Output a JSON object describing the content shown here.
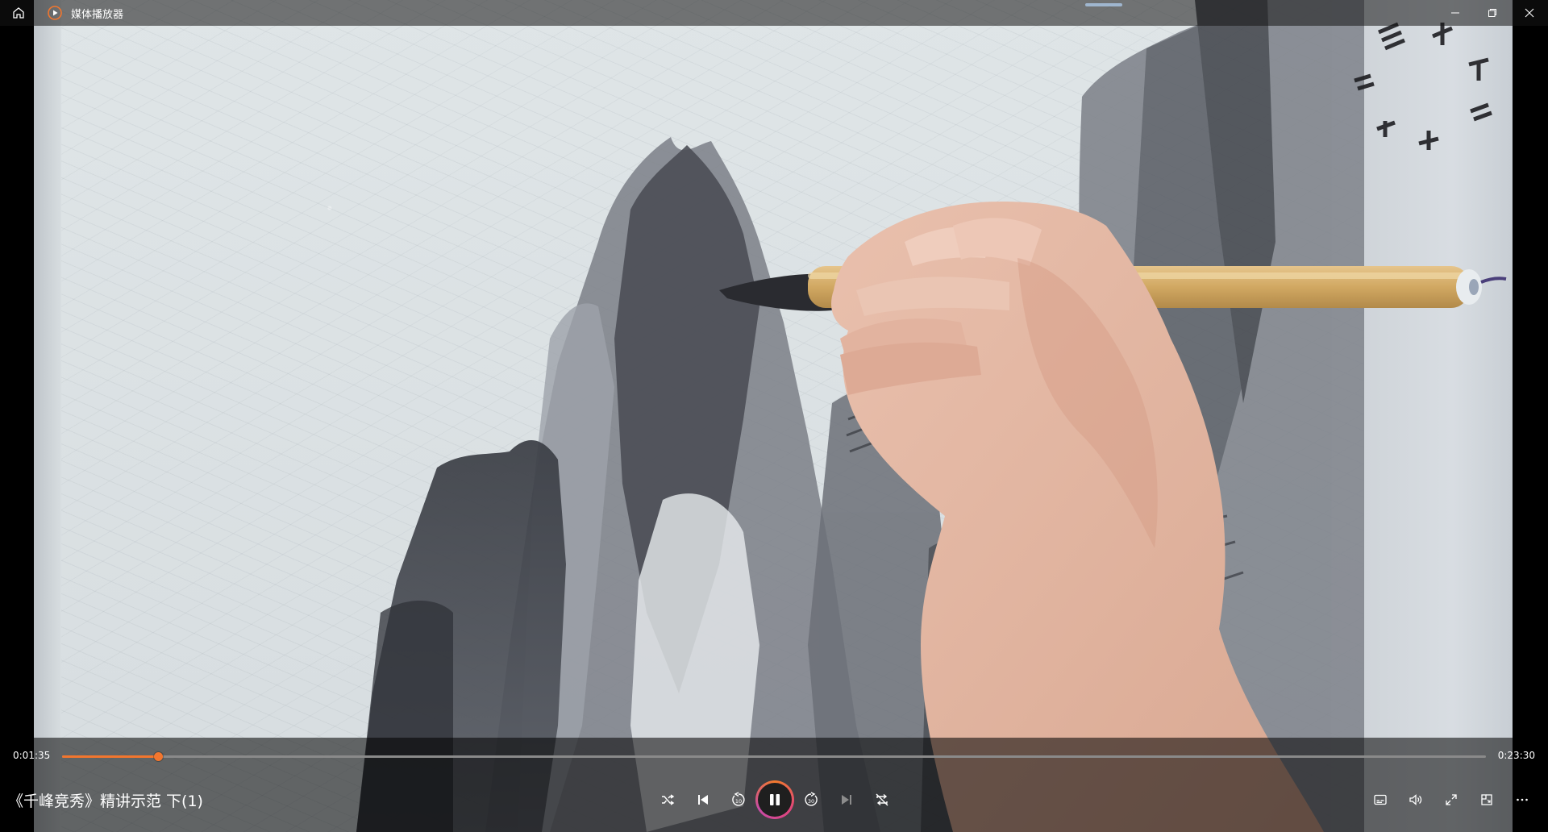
{
  "window": {
    "title": "媒体播放器",
    "controls": [
      "minimize-icon",
      "restore-icon",
      "close-icon"
    ]
  },
  "player": {
    "current_time": "0:01:35",
    "total_time": "0:23:30",
    "progress_fraction": 0.0674,
    "media_title": "《千峰竞秀》精讲示范 下(1)",
    "state": "playing",
    "accent_color": "#f2762e",
    "center_controls": [
      "shuffle-icon",
      "previous-icon",
      "rewind-10-icon",
      "pause-icon",
      "forward-30-icon",
      "next-icon",
      "repeat-off-icon"
    ],
    "right_controls": [
      "subtitles-icon",
      "volume-icon",
      "fullscreen-icon",
      "mini-player-icon",
      "more-icon"
    ]
  }
}
